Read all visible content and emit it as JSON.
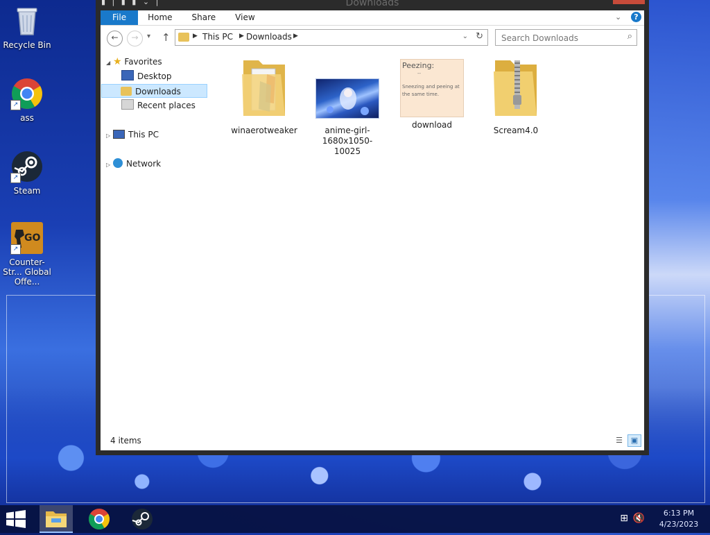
{
  "desktop": {
    "icons": [
      {
        "label": "Recycle Bin"
      },
      {
        "label": "ass"
      },
      {
        "label": "Steam"
      },
      {
        "label": "Counter-Str... Global Offe..."
      }
    ],
    "csgo_badge": "GO"
  },
  "window": {
    "title": "Downloads",
    "ribbon": {
      "tabs": [
        "File",
        "Home",
        "Share",
        "View"
      ],
      "help": "?"
    },
    "nav": {
      "back": "←",
      "forward": "→",
      "recent": "▾",
      "up": "↑",
      "breadcrumb": [
        "This PC",
        "Downloads"
      ],
      "search_placeholder": "Search Downloads"
    },
    "tree": {
      "favorites": "Favorites",
      "desktop": "Desktop",
      "downloads": "Downloads",
      "recent_places": "Recent places",
      "this_pc": "This PC",
      "network": "Network"
    },
    "files": [
      {
        "name": "winaerotweaker"
      },
      {
        "name": "anime-girl-1680x1050-10025"
      },
      {
        "name": "download",
        "preview_title": "Peezing:",
        "preview_dash": "--",
        "preview_text": "Sneezing and peeing at the same time."
      },
      {
        "name": "Scream4.0"
      }
    ],
    "status": {
      "count": "4 items"
    }
  },
  "taskbar": {
    "clock_time": "6:13 PM",
    "clock_date": "4/23/2023"
  },
  "colors": {
    "accent": "#1979ca",
    "selection": "#cce8ff",
    "folder": "#e8c25a"
  }
}
